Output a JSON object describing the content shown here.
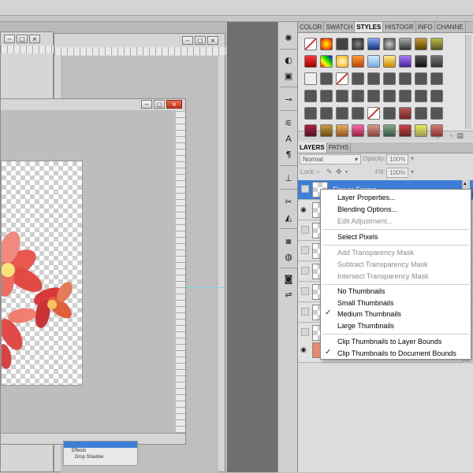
{
  "panels": {
    "styles_tabs": [
      "COLOR",
      "SWATCH",
      "STYLES",
      "HISTOGR",
      "INFO",
      "CHANNE"
    ],
    "active_styles_tab": "STYLES",
    "layers_tabs": [
      "LAYERS",
      "PATHS"
    ],
    "active_layers_tab": "LAYERS"
  },
  "layers_panel": {
    "blend_mode": "Normal",
    "opacity_label": "Opacity:",
    "opacity_value": "100%",
    "lock_label": "Lock:",
    "fill_label": "Fill:",
    "fill_value": "100%",
    "selected_layer_name": "Flower Frame"
  },
  "context_menu": {
    "items": [
      {
        "label": "Layer Properties...",
        "disabled": false,
        "checked": false
      },
      {
        "label": "Blending Options...",
        "disabled": false,
        "checked": false
      },
      {
        "label": "Edit Adjustment...",
        "disabled": true,
        "checked": false
      },
      {
        "label": "Select Pixels",
        "disabled": false,
        "checked": false
      },
      {
        "label": "Add Transparency Mask",
        "disabled": true,
        "checked": false
      },
      {
        "label": "Subtract Transparency Mask",
        "disabled": true,
        "checked": false
      },
      {
        "label": "Intersect Transparency Mask",
        "disabled": true,
        "checked": false
      },
      {
        "label": "No Thumbnails",
        "disabled": false,
        "checked": false
      },
      {
        "label": "Small Thumbnails",
        "disabled": false,
        "checked": false
      },
      {
        "label": "Medium Thumbnails",
        "disabled": false,
        "checked": true
      },
      {
        "label": "Large Thumbnails",
        "disabled": false,
        "checked": false
      },
      {
        "label": "Clip Thumbnails to Layer Bounds",
        "disabled": false,
        "checked": false
      },
      {
        "label": "Clip Thumbnails to Document Bounds",
        "disabled": false,
        "checked": true
      }
    ]
  },
  "mini_layers": {
    "effects_label": "Effects",
    "drop_shadow_label": "Drop Shadow"
  },
  "colors": {
    "menu_check": "#1c1c8c",
    "selected_layer": "#3d7fd6",
    "window_close": "#c5311c"
  }
}
